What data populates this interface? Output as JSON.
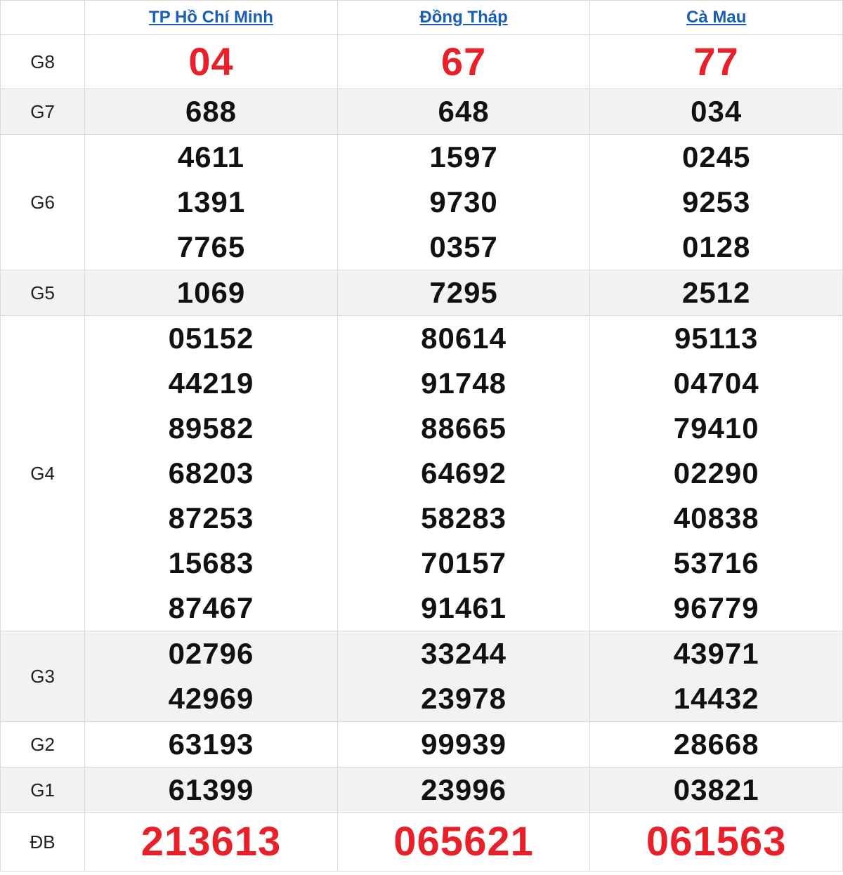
{
  "header": {
    "label": "",
    "provinces": [
      "TP Hồ Chí Minh",
      "Đồng Tháp",
      "Cà Mau"
    ]
  },
  "rows": [
    {
      "label": "G8",
      "values": [
        [
          "04"
        ],
        [
          "67"
        ],
        [
          "77"
        ]
      ],
      "highlight": true
    },
    {
      "label": "G7",
      "values": [
        [
          "688"
        ],
        [
          "648"
        ],
        [
          "034"
        ]
      ]
    },
    {
      "label": "G6",
      "values": [
        [
          "4611",
          "1391",
          "7765"
        ],
        [
          "1597",
          "9730",
          "0357"
        ],
        [
          "0245",
          "9253",
          "0128"
        ]
      ]
    },
    {
      "label": "G5",
      "values": [
        [
          "1069"
        ],
        [
          "7295"
        ],
        [
          "2512"
        ]
      ]
    },
    {
      "label": "G4",
      "values": [
        [
          "05152",
          "44219",
          "89582",
          "68203",
          "87253",
          "15683",
          "87467"
        ],
        [
          "80614",
          "91748",
          "88665",
          "64692",
          "58283",
          "70157",
          "91461"
        ],
        [
          "95113",
          "04704",
          "79410",
          "02290",
          "40838",
          "53716",
          "96779"
        ]
      ]
    },
    {
      "label": "G3",
      "values": [
        [
          "02796",
          "42969"
        ],
        [
          "33244",
          "23978"
        ],
        [
          "43971",
          "14432"
        ]
      ]
    },
    {
      "label": "G2",
      "values": [
        [
          "63193"
        ],
        [
          "99939"
        ],
        [
          "28668"
        ]
      ]
    },
    {
      "label": "G1",
      "values": [
        [
          "61399"
        ],
        [
          "23996"
        ],
        [
          "03821"
        ]
      ]
    },
    {
      "label": "ĐB",
      "values": [
        [
          "213613"
        ],
        [
          "065621"
        ],
        [
          "061563"
        ]
      ],
      "highlight": true
    }
  ],
  "colors": {
    "link": "#1a5fb4",
    "highlight_number": "#e8202a",
    "row_alt_bg": "#f2f2f2",
    "border": "#d9d9d9"
  }
}
